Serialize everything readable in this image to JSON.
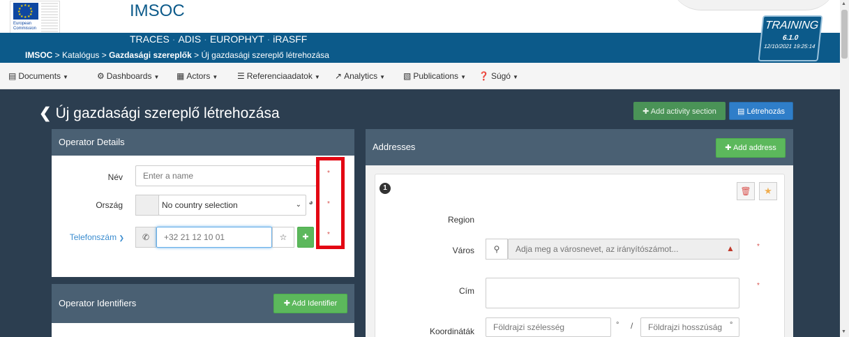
{
  "header": {
    "ec_label": "European Commission",
    "app_title": "IMSOC",
    "systems": [
      "TRACES",
      "ADIS",
      "EUROPHYT",
      "iRASFF"
    ],
    "breadcrumb": {
      "part1": "IMSOC",
      "part2": "Katalógus",
      "part3": "Gazdasági szereplők",
      "part4": "Új gazdasági szereplő létrehozása",
      "sep": " > "
    },
    "env": {
      "name": "TRAINING",
      "version": "6.1.0",
      "datetime": "12/10/2021 19:25:14"
    }
  },
  "nav": {
    "items": [
      {
        "label": "Documents",
        "icon": "document-icon"
      },
      {
        "label": "Dashboards",
        "icon": "dashboard-icon"
      },
      {
        "label": "Actors",
        "icon": "id-card-icon"
      },
      {
        "label": "Referenciaadatok",
        "icon": "database-icon"
      },
      {
        "label": "Analytics",
        "icon": "chart-line-icon"
      },
      {
        "label": "Publications",
        "icon": "book-icon"
      },
      {
        "label": "Súgó",
        "icon": "question-circle-icon"
      }
    ]
  },
  "page": {
    "title": "Új gazdasági szereplő létrehozása",
    "add_activity_label": "Add activity section",
    "create_label": "Létrehozás"
  },
  "operator_details": {
    "heading": "Operator Details",
    "name_label": "Név",
    "name_placeholder": "Enter a name",
    "country_label": "Ország",
    "country_value": "No country selection",
    "phone_label": "Telefonszám",
    "phone_placeholder": "+32 21 12 10 01",
    "required_mark": "*"
  },
  "operator_identifiers": {
    "heading": "Operator Identifiers",
    "add_label": "Add Identifier"
  },
  "addresses": {
    "heading": "Addresses",
    "add_label": "Add address",
    "entry_number": "1",
    "region_label": "Region",
    "city_label": "Város",
    "city_placeholder": "Adja meg a városnevet, az irányítószámot...",
    "address_label": "Cím",
    "coords_label": "Koordináták",
    "lat_placeholder": "Földrajzi szélesség",
    "lon_placeholder": "Földrajzi hosszúság",
    "degree": "°",
    "slash": "/",
    "required_mark": "*"
  },
  "colors": {
    "header_blue": "#0c5a8a",
    "dark_bg": "#2c3e50",
    "panel_head": "#4a6073",
    "green": "#5cb85c",
    "blue": "#2f7ec9",
    "highlight_red": "#e30613"
  }
}
